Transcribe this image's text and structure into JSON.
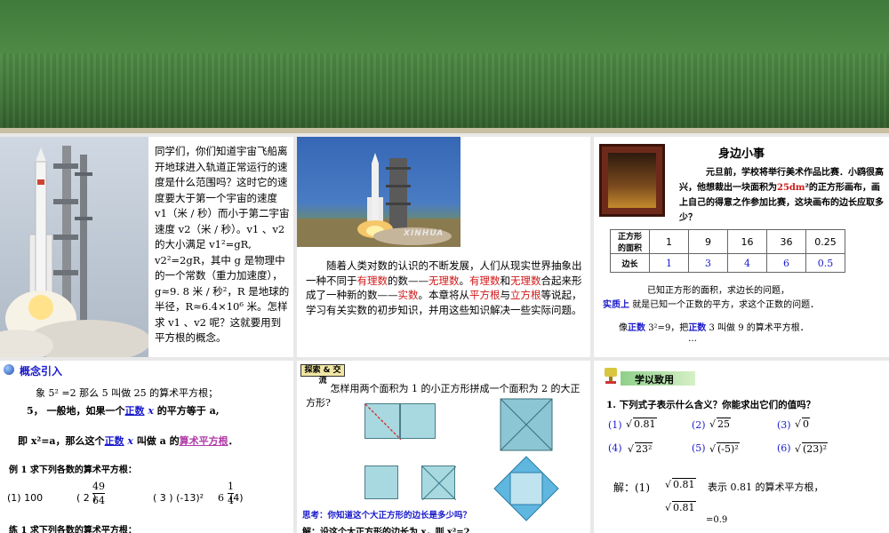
{
  "panel1": {
    "text": "同学们，你们知道宇宙飞船离开地球进入轨道正常运行的速度是什么范围吗？这时它的速度要大于第一个宇宙的速度 v1（米 / 秒）而小于第二宇宙速度 v2（米 / 秒）。v1 、v2 的大小满足 v1²=gR, v2²=2gR，其中 g 是物理中的一个常数（重力加速度），g≈9. 8 米 / 秒²，R 是地球的半径，R≈6.4×10⁶ 米。怎样求 v1 、v2 呢？这就要用到平方根的概念。"
  },
  "panel2": {
    "watermark": "XINHUA",
    "t1": "随着人类对数的认识的不断发展，人们从现实世界抽象出一种不同于",
    "rational": "有理数",
    "t2": "的数——",
    "irrational": "无理数",
    "t3": "。",
    "rational2": "有理数",
    "t4": "和",
    "irrational2": "无理数",
    "t5": "合起来形成了一种新的数——",
    "real": "实数",
    "t6": "。本章将从",
    "sqroot": "平方根",
    "t7": "与",
    "cuberoot": "立方根",
    "t8": "等说起，学习有关实数的初步知识，并用这些知识解决一些实际问题。"
  },
  "panel3": {
    "title": "身边小事",
    "story_a": "元旦前，学校将举行美术作品比赛．小鸥很高兴，他想裁出一块面积为",
    "area": "25dm",
    "story_b": "²的正方形画布，画上自己的得意之作参加比赛，这块画布的边长应取多少？",
    "table": {
      "row1_head": "正方形的面积",
      "row1": [
        "1",
        "9",
        "16",
        "36",
        "0.25"
      ],
      "row2_head": "边长",
      "row2": [
        "1",
        "3",
        "4",
        "6",
        "0.5"
      ]
    },
    "line1": "已知正方形的面积，求边长的问题，",
    "essence": "实质上",
    "line2": "就是已知一个正数的平方，求这个正数的问题．",
    "line3_a": "像",
    "positive1": "正数",
    "line3_b": "3²=9，把",
    "positive2": "正数",
    "line3_c": "3 叫做 9 的算术平方根．",
    "dots": "…"
  },
  "panel4": {
    "title": "概念引入",
    "l1": "象 5² =2  那么 5 叫做 25 的算术平方根；",
    "l2a": "5，     一般地，如果一个",
    "l2pos": "正数",
    "l2x": "x",
    "l2b": "的平方等于 a,",
    "l3a": "即 x²=a，那么这个",
    "l3pos": "正数",
    "l3x": "x",
    "l3b": "叫做 a 的",
    "l3c": "算术平方根",
    "l3d": "．",
    "ex1": "例 1  求下列各数的算术平方根：",
    "ex1_a": "(1) 100",
    "ex1_b": "( 2 )",
    "ex1_b_num": "49",
    "ex1_b_den": "64",
    "ex1_c": "( 3 )  (-13)²",
    "ex1_d": "6",
    "ex1_d_num": "1",
    "ex1_d_den": "4",
    "ex1_d_tail": "(4)",
    "ex2": "练 1  求下列各数的算术平方根："
  },
  "panel5": {
    "tag": "探索 & 交流",
    "question": "怎样用两个面积为 1 的小正方形拼成一个面积为 2 的大正方形?",
    "think": "思考：你知道这个大正方形的边长是多少吗？",
    "solution": "解：设这个大正方形的边长为 x，则 x²=2"
  },
  "panel6": {
    "title": "学以致用",
    "question": "1. 下列式子表示什么含义？你能求出它们的值吗？",
    "items": [
      "(1)",
      "0.81",
      "(2)",
      "25",
      "(3)",
      "0",
      "(4)",
      "23²",
      "(5)",
      "(-5)²",
      "(6)",
      "(23)²"
    ],
    "sol_label": "解：(1)",
    "sol_root": "0.81",
    "sol_text": "表示 0.81 的算术平方根，",
    "sol_eq": "=0.9"
  }
}
